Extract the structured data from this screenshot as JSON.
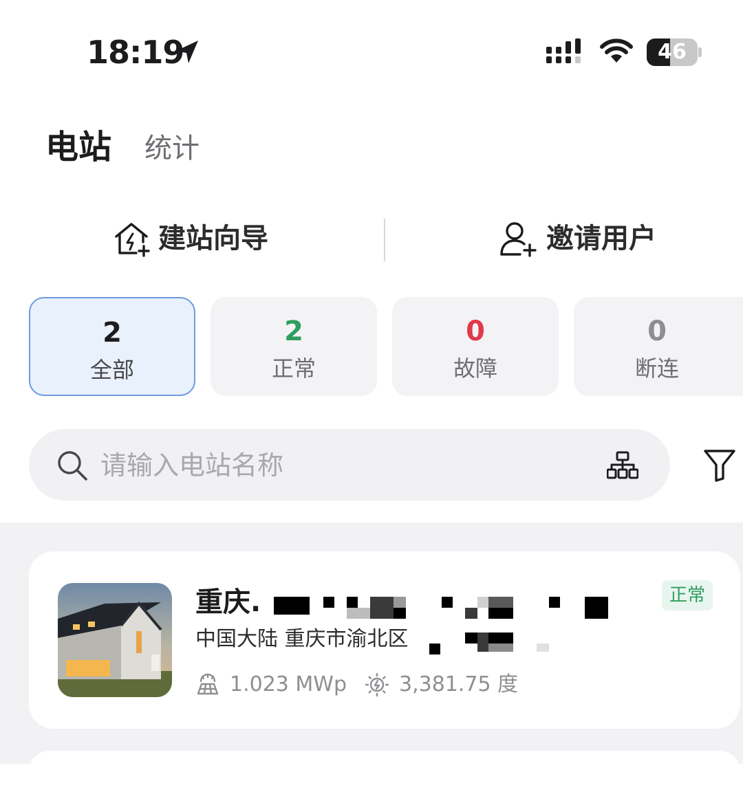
{
  "status_bar": {
    "time": "18:19",
    "battery_level": "46",
    "battery_fraction": 0.46
  },
  "header": {
    "tabs": [
      {
        "label": "电站",
        "active": true
      },
      {
        "label": "统计",
        "active": false
      }
    ]
  },
  "actions": {
    "build_label": "建站向导",
    "invite_label": "邀请用户"
  },
  "filters": [
    {
      "count": "2",
      "label": "全部",
      "color": "#1c1c1e",
      "active": true
    },
    {
      "count": "2",
      "label": "正常",
      "color": "#2f9e5e",
      "active": false
    },
    {
      "count": "0",
      "label": "故障",
      "color": "#e03a4a",
      "active": false
    },
    {
      "count": "0",
      "label": "断连",
      "color": "#8e8e93",
      "active": false
    }
  ],
  "search": {
    "placeholder": "请输入电站名称",
    "value": ""
  },
  "stations": [
    {
      "name": "重庆.",
      "address": "中国大陆 重庆市渝北区",
      "capacity": "1.023 MWp",
      "energy": "3,381.75 度",
      "status": "正常"
    }
  ],
  "colors": {
    "accent_blue": "#6b9be0",
    "normal_green": "#2f9e5e",
    "fault_red": "#e03a4a"
  },
  "icons": [
    "location-arrow-icon",
    "signal-icon",
    "wifi-icon",
    "battery-icon",
    "house-add-icon",
    "user-add-icon",
    "search-icon",
    "org-structure-icon",
    "filter-icon",
    "solar-panel-icon",
    "sun-energy-icon"
  ]
}
